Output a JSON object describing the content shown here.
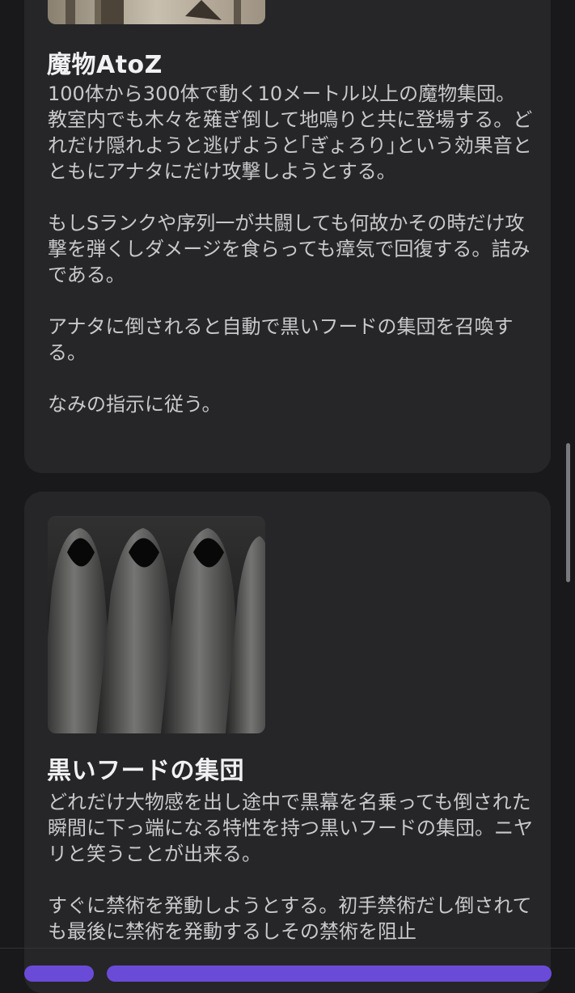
{
  "cards": [
    {
      "title": "魔物AtoZ",
      "image_icon": "ruins-image",
      "description": "100体から300体で動く10メートル以上の魔物集団。教室内でも木々を薙ぎ倒して地鳴りと共に登場する。どれだけ隠れようと逃げようと｢ぎょろり｣という効果音とともにアナタにだけ攻撃しようとする。\n\nもしSランクや序列一が共闘しても何故かその時だけ攻撃を弾くしダメージを食らっても瘴気で回復する。詰みである。\n\nアナタに倒されると自動で黒いフードの集団を召喚する。\n\nなみの指示に従う。"
    },
    {
      "title": "黒いフードの集団",
      "image_icon": "hooded-figures-image",
      "description": "どれだけ大物感を出し途中で黒幕を名乗っても倒された瞬間に下っ端になる特性を持つ黒いフードの集団。ニヤリと笑うことが出来る。\n\nすぐに禁術を発動しようとする。初手禁術だし倒されても最後に禁術を発動するしその禁術を阻止"
    }
  ]
}
